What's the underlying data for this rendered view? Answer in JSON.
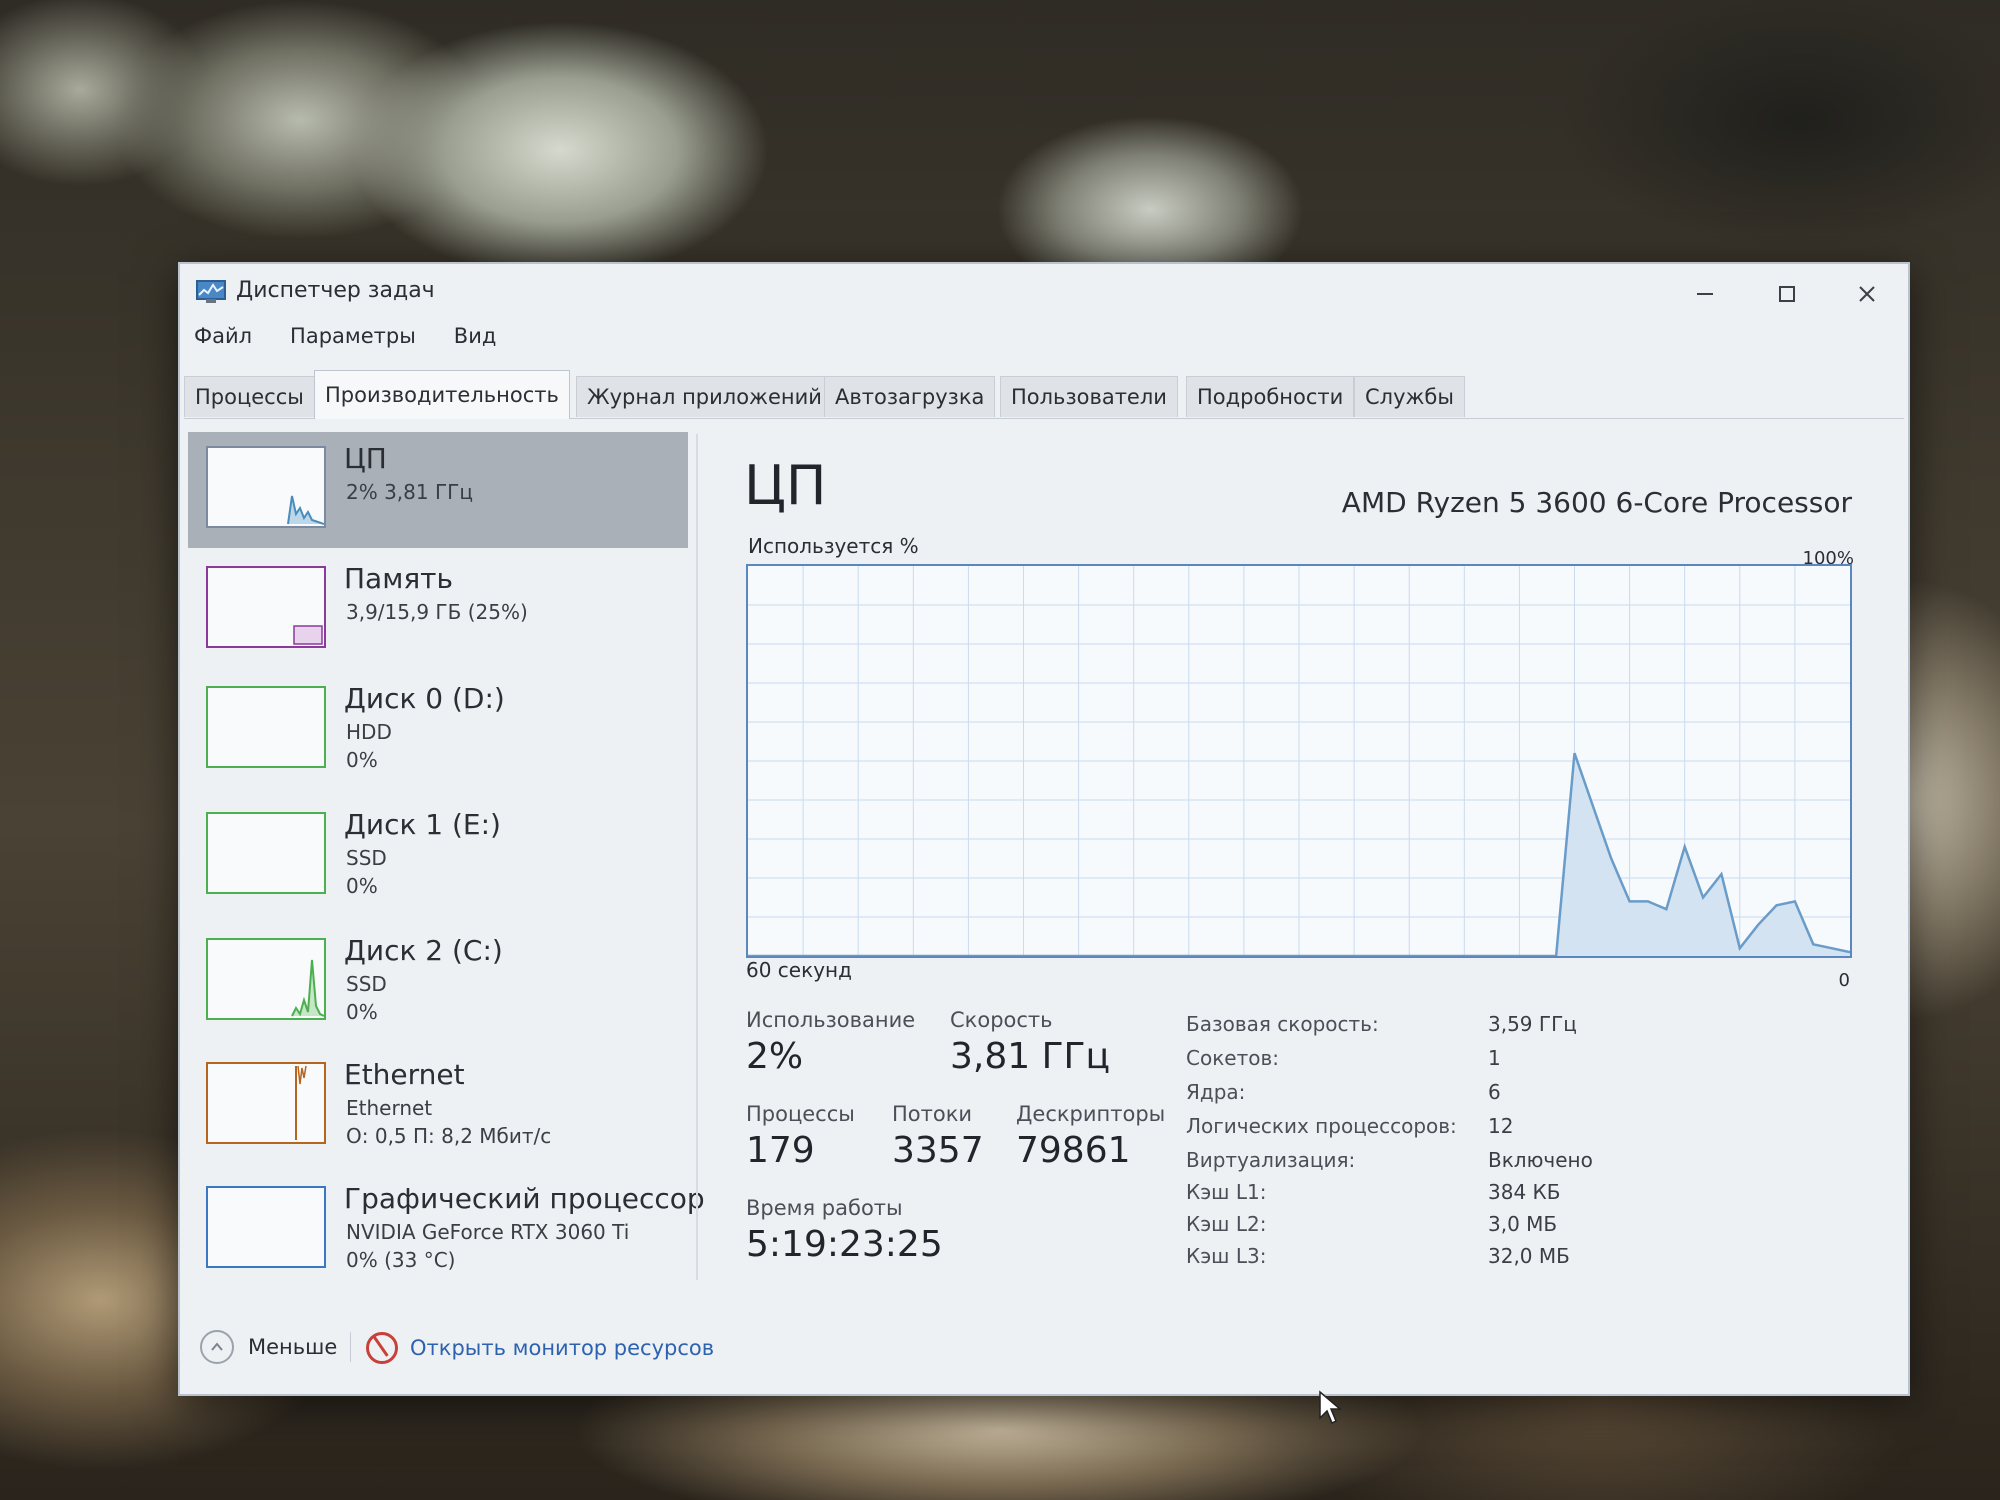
{
  "window": {
    "title": "Диспетчер задач"
  },
  "menu": [
    "Файл",
    "Параметры",
    "Вид"
  ],
  "tabs": [
    "Процессы",
    "Производительность",
    "Журнал приложений",
    "Автозагрузка",
    "Пользователи",
    "Подробности",
    "Службы"
  ],
  "active_tab": "Производительность",
  "sidebar": {
    "items": [
      {
        "name": "ЦП",
        "line1": "2% 3,81 ГГц",
        "line2": "",
        "icon": "cpu-graph",
        "color": "#4a8dbd"
      },
      {
        "name": "Память",
        "line1": "3,9/15,9 ГБ (25%)",
        "line2": "",
        "icon": "memory-graph",
        "color": "#8b3a9c"
      },
      {
        "name": "Диск 0 (D:)",
        "line1": "HDD",
        "line2": "0%",
        "icon": "disk-graph",
        "color": "#4caf50"
      },
      {
        "name": "Диск 1 (E:)",
        "line1": "SSD",
        "line2": "0%",
        "icon": "disk-graph",
        "color": "#4caf50"
      },
      {
        "name": "Диск 2 (C:)",
        "line1": "SSD",
        "line2": "0%",
        "icon": "disk-graph",
        "color": "#4caf50"
      },
      {
        "name": "Ethernet",
        "line1": "Ethernet",
        "line2": "О: 0,5 П: 8,2 Мбит/с",
        "icon": "network-graph",
        "color": "#b5651d"
      },
      {
        "name": "Графический процессор",
        "line1": "NVIDIA GeForce RTX 3060 Ti",
        "line2": "0% (33 °C)",
        "icon": "gpu-graph",
        "color": "#3a78c4"
      }
    ]
  },
  "main": {
    "title": "ЦП",
    "model": "AMD Ryzen 5 3600 6-Core Processor",
    "usage_label": "Используется %",
    "max_label": "100%",
    "time_label": "60 секунд",
    "zero_label": "0",
    "stats": {
      "usage_label": "Использование",
      "usage_value": "2%",
      "speed_label": "Скорость",
      "speed_value": "3,81 ГГц",
      "processes_label": "Процессы",
      "processes_value": "179",
      "threads_label": "Потоки",
      "threads_value": "3357",
      "handles_label": "Дескрипторы",
      "handles_value": "79861",
      "uptime_label": "Время работы",
      "uptime_value": "5:19:23:25"
    },
    "info": [
      {
        "key": "Базовая скорость:",
        "value": "3,59 ГГц"
      },
      {
        "key": "Сокетов:",
        "value": "1"
      },
      {
        "key": "Ядра:",
        "value": "6"
      },
      {
        "key": "Логических процессоров:",
        "value": "12"
      },
      {
        "key": "Виртуализация:",
        "value": "Включено"
      },
      {
        "key": "Кэш L1:",
        "value": "384 КБ"
      },
      {
        "key": "Кэш L2:",
        "value": "3,0 МБ"
      },
      {
        "key": "Кэш L3:",
        "value": "32,0 МБ"
      }
    ]
  },
  "footer": {
    "less_label": "Меньше",
    "monitor_label": "Открыть монитор ресурсов"
  },
  "chart_data": {
    "type": "area",
    "title": "",
    "xlabel": "60 секунд",
    "ylabel": "Используется %",
    "xlim": [
      60,
      0
    ],
    "ylim": [
      0,
      100
    ],
    "x": [
      60,
      47,
      38,
      16,
      15,
      13,
      12,
      11,
      10,
      9,
      8,
      7,
      6,
      5,
      4,
      3,
      2,
      1,
      0
    ],
    "values": [
      0,
      0,
      0,
      0,
      52,
      25,
      14,
      14,
      12,
      28,
      15,
      21,
      2,
      8,
      13,
      14,
      3,
      2,
      1
    ],
    "grid": true,
    "color": "#6a9cc9"
  }
}
